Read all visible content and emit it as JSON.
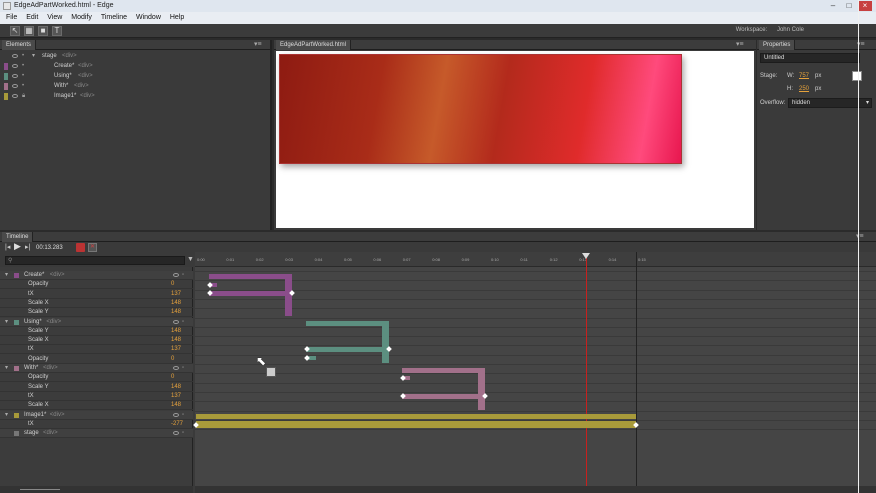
{
  "window": {
    "title": "EdgeAdPartWorked.html - Edge"
  },
  "menu": [
    "File",
    "Edit",
    "View",
    "Modify",
    "Timeline",
    "Window",
    "Help"
  ],
  "workspace": {
    "label": "Workspace:",
    "value": "John Cole"
  },
  "elements_panel": {
    "tab": "Elements",
    "items": [
      {
        "name": "stage",
        "tag": "<div>"
      },
      {
        "name": "Create*",
        "tag": "<div>"
      },
      {
        "name": "Using*",
        "tag": "<div>"
      },
      {
        "name": "With*",
        "tag": "<div>"
      },
      {
        "name": "Image1*",
        "tag": "<div>"
      }
    ]
  },
  "stage_panel": {
    "tab": "EdgeAdPartWorked.html"
  },
  "properties": {
    "tab": "Properties",
    "name_field": "Untitled",
    "stage_label": "Stage:",
    "w_label": "W:",
    "w_value": "757",
    "w_unit": "px",
    "h_label": "H:",
    "h_value": "250",
    "h_unit": "px",
    "overflow_label": "Overflow:",
    "overflow_value": "hidden"
  },
  "timeline": {
    "tab": "Timeline",
    "time": "00:13.283",
    "ticks": [
      "0:00",
      "0:01",
      "0:02",
      "0:03",
      "0:04",
      "0:05",
      "0:06",
      "0:07",
      "0:08",
      "0:09",
      "0:10",
      "0:11",
      "0:12",
      "0:13",
      "0:14",
      "0:15"
    ],
    "rows": [
      {
        "label": "Create*",
        "tag": "<div>",
        "group": true
      },
      {
        "label": "Opacity",
        "value": "0"
      },
      {
        "label": "tX",
        "value": "137"
      },
      {
        "label": "Scale X",
        "value": "148"
      },
      {
        "label": "Scale Y",
        "value": "148"
      },
      {
        "label": "Using*",
        "tag": "<div>",
        "group": true
      },
      {
        "label": "Scale Y",
        "value": "148"
      },
      {
        "label": "Scale X",
        "value": "148"
      },
      {
        "label": "tX",
        "value": "137"
      },
      {
        "label": "Opacity",
        "value": "0"
      },
      {
        "label": "With*",
        "tag": "<div>",
        "group": true
      },
      {
        "label": "Opacity",
        "value": "0"
      },
      {
        "label": "Scale Y",
        "value": "148"
      },
      {
        "label": "tX",
        "value": "137"
      },
      {
        "label": "Scale X",
        "value": "148"
      },
      {
        "label": "Image1*",
        "tag": "<div>",
        "group": true
      },
      {
        "label": "tX",
        "value": "-277"
      },
      {
        "label": "stage",
        "tag": "<div>",
        "group": true
      }
    ]
  },
  "colors": {
    "create": "#8a4d8a",
    "using": "#5c8f80",
    "with": "#a2708a",
    "image": "#a89a3a",
    "stage": "#777777"
  }
}
